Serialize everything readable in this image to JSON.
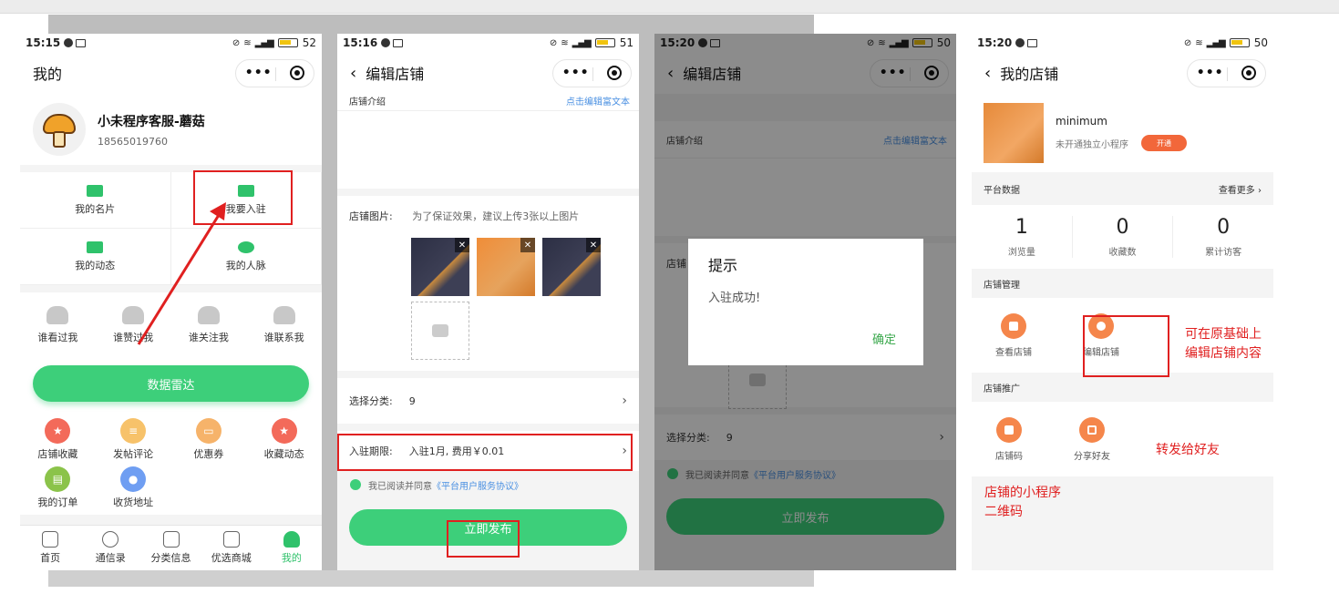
{
  "phone1": {
    "status": {
      "time": "15:15",
      "battery": "52"
    },
    "title": "我的",
    "profile": {
      "name": "小未程序客服-蘑菇",
      "phone": "18565019760"
    },
    "grid": [
      "我的名片",
      "我要入驻",
      "我的动态",
      "我的人脉"
    ],
    "stats": [
      "谁看过我",
      "谁赞过我",
      "谁关注我",
      "谁联系我"
    ],
    "radar_button": "数据雷达",
    "shortcuts": [
      {
        "label": "店铺收藏",
        "color": "#f36a5a"
      },
      {
        "label": "发帖评论",
        "color": "#f7c26a"
      },
      {
        "label": "优惠券",
        "color": "#f6b36a"
      },
      {
        "label": "收藏动态",
        "color": "#f36a5a"
      },
      {
        "label": "我的订单",
        "color": "#8bc34a"
      },
      {
        "label": "收货地址",
        "color": "#6f9ef2"
      }
    ],
    "tabs": [
      "首页",
      "通信录",
      "分类信息",
      "优选商城",
      "我的"
    ]
  },
  "phone2": {
    "status": {
      "time": "15:16",
      "battery": "51"
    },
    "title": "编辑店铺",
    "intro_label": "店铺介绍",
    "edit_rich_text": "点击编辑富文本",
    "images_label": "店铺图片:",
    "images_hint": "为了保证效果，建议上传3张以上图片",
    "category_label": "选择分类:",
    "category_value": "9",
    "period_label": "入驻期限:",
    "period_value": "入驻1月, 费用￥0.01",
    "agree_text": "我已阅读并同意",
    "agreement_link": "《平台用户服务协议》",
    "publish_button": "立即发布"
  },
  "phone3": {
    "status": {
      "time": "15:20",
      "battery": "50"
    },
    "title": "编辑店铺",
    "intro_label": "店铺介绍",
    "edit_rich_text": "点击编辑富文本",
    "images_label_partial": "店铺",
    "category_label": "选择分类:",
    "category_value": "9",
    "agree_text": "我已阅读并同意",
    "agreement_link": "《平台用户服务协议》",
    "publish_button": "立即发布",
    "modal": {
      "title": "提示",
      "content": "入驻成功!",
      "confirm": "确定"
    }
  },
  "phone4": {
    "status": {
      "time": "15:20",
      "battery": "50"
    },
    "title": "我的店铺",
    "shop": {
      "name": "minimum",
      "sub": "未开通独立小程序",
      "open_button": "开通"
    },
    "platform_data_label": "平台数据",
    "view_more": "查看更多",
    "metrics": [
      {
        "value": "1",
        "label": "浏览量"
      },
      {
        "value": "0",
        "label": "收藏数"
      },
      {
        "value": "0",
        "label": "累计访客"
      }
    ],
    "manage_label": "店铺管理",
    "manage_items": [
      "查看店铺",
      "编辑店铺"
    ],
    "promote_label": "店铺推广",
    "promote_items": [
      "店铺码",
      "分享好友"
    ]
  },
  "annotations": {
    "edit_note_line1": "可在原基础上",
    "edit_note_line2": "编辑店铺内容",
    "share_note": "转发给好友",
    "qr_note_line1": "店铺的小程序",
    "qr_note_line2": "二维码"
  },
  "colors": {
    "green": "#3dcf7a",
    "orange": "#f5864b",
    "annotation_red": "#e02020"
  }
}
